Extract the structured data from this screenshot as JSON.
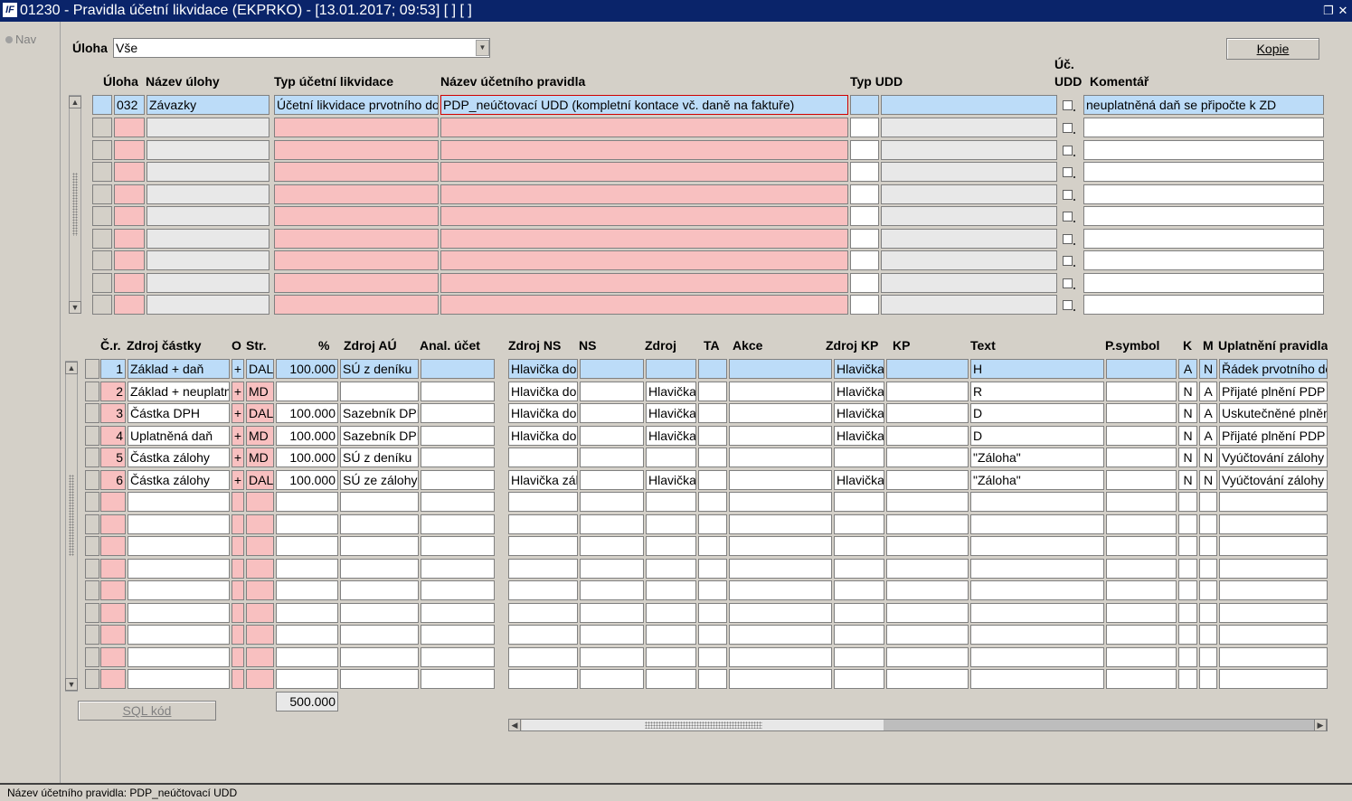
{
  "window": {
    "title": "01230 - Pravidla účetní likvidace (EKPRKO) - [13.01.2017; 09:53]  [ ]  [ ]",
    "logo": "IF",
    "restore_glyph": "❐",
    "close_glyph": "✕"
  },
  "nav": {
    "label": "Nav"
  },
  "filter": {
    "label": "Úloha",
    "value": "Vše",
    "arrow": "▼"
  },
  "buttons": {
    "kopie": "Kopie",
    "sql": "SQL kód"
  },
  "scroll": {
    "up": "▲",
    "down": "▼",
    "left": "◀",
    "right": "▶"
  },
  "top_table": {
    "headers": {
      "uloha": "Úloha",
      "nazev_ulohy": "Název úlohy",
      "typ_likv": "Typ účetní likvidace",
      "nazev_pravidla": "Název účetního pravidla",
      "typ_udd": "Typ UDD",
      "uc_udd_1": "Úč.",
      "uc_udd_2": "UDD",
      "komentar": "Komentář"
    },
    "row1": {
      "uloha": "032",
      "nazev_ulohy": "Závazky",
      "typ_likv": "Účetní likvidace prvotního dokladu",
      "nazev_pravidla": "PDP_neúčtovací UDD (kompletní kontace vč. daně na faktuře)",
      "typ_udd": "",
      "udd": "",
      "komentar": "neuplatněná daň se připočte k ZD"
    }
  },
  "bottom_table": {
    "headers": {
      "cr": "Č.r.",
      "zdroj_castky": "Zdroj částky",
      "o": "O",
      "str": "Str.",
      "pct": "%",
      "zdroj_au": "Zdroj AÚ",
      "anal_ucet": "Anal. účet",
      "zdroj_ns": "Zdroj NS",
      "ns": "NS",
      "zdroj": "Zdroj",
      "ta": "TA",
      "akce": "Akce",
      "zdroj_kp": "Zdroj KP",
      "kp": "KP",
      "text": "Text",
      "psymbol": "P.symbol",
      "k": "K",
      "m": "M",
      "uplatneni": "Uplatnění pravidla"
    },
    "rows": [
      {
        "cr": "1",
        "zdroj_castky": "Základ + daň",
        "o": "+",
        "str": "DAL",
        "pct": "100.000",
        "zdroj_au": "SÚ z deníku",
        "anal": "",
        "zdroj_ns": "Hlavička dokladu",
        "ns": "",
        "zdroj": "",
        "ta": "",
        "akce": "",
        "zdroj_kp": "Hlavička",
        "kp": "",
        "text": "H",
        "psymbol": "",
        "k": "A",
        "m": "N",
        "uplatneni": "Řádek prvotního dokladu"
      },
      {
        "cr": "2",
        "zdroj_castky": "Základ + neuplatněná daň",
        "o": "+",
        "str": "MD",
        "pct": "",
        "zdroj_au": "",
        "anal": "",
        "zdroj_ns": "Hlavička dokladu",
        "ns": "",
        "zdroj": "Hlavička",
        "ta": "",
        "akce": "",
        "zdroj_kp": "Hlavička",
        "kp": "",
        "text": "R",
        "psymbol": "",
        "k": "N",
        "m": "A",
        "uplatneni": "Přijaté plnění PDP"
      },
      {
        "cr": "3",
        "zdroj_castky": "Částka DPH",
        "o": "+",
        "str": "DAL",
        "pct": "100.000",
        "zdroj_au": "Sazebník DPH",
        "anal": "",
        "zdroj_ns": "Hlavička dokladu",
        "ns": "",
        "zdroj": "Hlavička",
        "ta": "",
        "akce": "",
        "zdroj_kp": "Hlavička",
        "kp": "",
        "text": "D",
        "psymbol": "",
        "k": "N",
        "m": "A",
        "uplatneni": "Uskutečněné plnění"
      },
      {
        "cr": "4",
        "zdroj_castky": "Uplatněná daň",
        "o": "+",
        "str": "MD",
        "pct": "100.000",
        "zdroj_au": "Sazebník DPH",
        "anal": "",
        "zdroj_ns": "Hlavička dokladu",
        "ns": "",
        "zdroj": "Hlavička",
        "ta": "",
        "akce": "",
        "zdroj_kp": "Hlavička",
        "kp": "",
        "text": "D",
        "psymbol": "",
        "k": "N",
        "m": "A",
        "uplatneni": "Přijaté plnění PDP"
      },
      {
        "cr": "5",
        "zdroj_castky": "Částka zálohy",
        "o": "+",
        "str": "MD",
        "pct": "100.000",
        "zdroj_au": "SÚ z deníku",
        "anal": "",
        "zdroj_ns": "",
        "ns": "",
        "zdroj": "",
        "ta": "",
        "akce": "",
        "zdroj_kp": "",
        "kp": "",
        "text": "\"Záloha\"",
        "psymbol": "",
        "k": "N",
        "m": "N",
        "uplatneni": "Vyúčtování zálohy"
      },
      {
        "cr": "6",
        "zdroj_castky": "Částka zálohy",
        "o": "+",
        "str": "DAL",
        "pct": "100.000",
        "zdroj_au": "SÚ ze zálohy",
        "anal": "",
        "zdroj_ns": "Hlavička zálohy",
        "ns": "",
        "zdroj": "Hlavička",
        "ta": "",
        "akce": "",
        "zdroj_kp": "Hlavička",
        "kp": "",
        "text": "\"Záloha\"",
        "psymbol": "",
        "k": "N",
        "m": "N",
        "uplatneni": "Vyúčtování zálohy"
      }
    ],
    "total": "500.000"
  },
  "status": {
    "text": "Název účetního pravidla: PDP_neúčtovací UDD"
  }
}
